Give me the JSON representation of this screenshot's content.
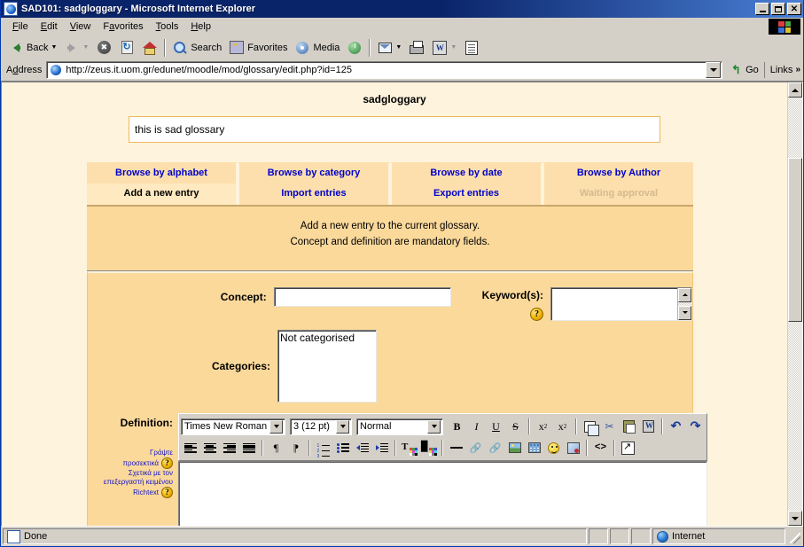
{
  "window": {
    "title": "SAD101: sadgloggary - Microsoft Internet Explorer",
    "minimize_label": "Minimize",
    "maximize_label": "Maximize",
    "close_label": "Close"
  },
  "menu": {
    "items": [
      {
        "label": "File"
      },
      {
        "label": "Edit"
      },
      {
        "label": "View"
      },
      {
        "label": "Favorites"
      },
      {
        "label": "Tools"
      },
      {
        "label": "Help"
      }
    ]
  },
  "toolbar": {
    "back": "Back",
    "search": "Search",
    "favorites": "Favorites",
    "media": "Media"
  },
  "address": {
    "label": "Address",
    "url": "http://zeus.it.uom.gr/edunet/moodle/mod/glossary/edit.php?id=125",
    "placeholder": "",
    "go": "Go",
    "links": "Links"
  },
  "page": {
    "glossary_title": "sadgloggary",
    "intro_text": "this is sad glossary",
    "tabs_row1": [
      {
        "label": "Browse by alphabet",
        "state": "normal"
      },
      {
        "label": "Browse by category",
        "state": "normal"
      },
      {
        "label": "Browse by date",
        "state": "normal"
      },
      {
        "label": "Browse by Author",
        "state": "normal"
      }
    ],
    "tabs_row2": [
      {
        "label": "Add a new entry",
        "state": "selected"
      },
      {
        "label": "Import entries",
        "state": "normal"
      },
      {
        "label": "Export entries",
        "state": "normal"
      },
      {
        "label": "Waiting approval",
        "state": "disabled"
      }
    ],
    "description_line1": "Add a new entry to the current glossary.",
    "description_line2": "Concept and definition are mandatory fields.",
    "form": {
      "concept_label": "Concept:",
      "concept_value": "",
      "keywords_label": "Keyword(s):",
      "keywords_value": "",
      "keywords_help": "?",
      "categories_label": "Categories:",
      "categories_options": [
        "Not categorised"
      ],
      "categories_selected": "Not categorised",
      "definition_label": "Definition:",
      "definition_value": "",
      "help_greek_line1": "Γράψτε",
      "help_greek_line2": "προσεκτικά",
      "help_greek_line3": "Σχετικά με τον",
      "help_greek_line4": "επεξεργαστή κειμένου",
      "help_richtext": "Richtext",
      "help_mark": "?"
    },
    "editor": {
      "font_family": "Times New Roman",
      "font_size": "3 (12 pt)",
      "paragraph_style": "Normal",
      "buttons_row1": [
        {
          "name": "bold",
          "glyph": "B"
        },
        {
          "name": "italic",
          "glyph": "I"
        },
        {
          "name": "underline",
          "glyph": "U"
        },
        {
          "name": "strikethrough",
          "glyph": "S"
        },
        {
          "name": "subscript",
          "glyph": "x"
        },
        {
          "name": "superscript",
          "glyph": "x"
        },
        {
          "name": "copy",
          "glyph": ""
        },
        {
          "name": "cut",
          "glyph": ""
        },
        {
          "name": "paste",
          "glyph": ""
        },
        {
          "name": "paste-from-word",
          "glyph": ""
        },
        {
          "name": "undo",
          "glyph": ""
        },
        {
          "name": "redo",
          "glyph": ""
        }
      ],
      "buttons_row2": [
        {
          "name": "align-left"
        },
        {
          "name": "align-center"
        },
        {
          "name": "align-right"
        },
        {
          "name": "align-justify"
        },
        {
          "name": "direction-rtl"
        },
        {
          "name": "direction-ltr"
        },
        {
          "name": "ordered-list"
        },
        {
          "name": "unordered-list"
        },
        {
          "name": "outdent"
        },
        {
          "name": "indent"
        },
        {
          "name": "text-color"
        },
        {
          "name": "background-color"
        },
        {
          "name": "horizontal-rule"
        },
        {
          "name": "insert-link"
        },
        {
          "name": "unlink"
        },
        {
          "name": "insert-image"
        },
        {
          "name": "insert-table"
        },
        {
          "name": "insert-emoticon"
        },
        {
          "name": "spellcheck"
        },
        {
          "name": "html-source"
        },
        {
          "name": "fullscreen"
        }
      ]
    }
  },
  "statusbar": {
    "status": "Done",
    "zone": "Internet"
  },
  "colors": {
    "page_background": "#fef3dc",
    "panel_background": "#fbd99b",
    "tab_background": "#fcdfad",
    "tab_selected": "#ffe9c0",
    "link_blue": "#0000cc",
    "title_bar": "#0a246a",
    "chrome": "#d4d0c8"
  }
}
